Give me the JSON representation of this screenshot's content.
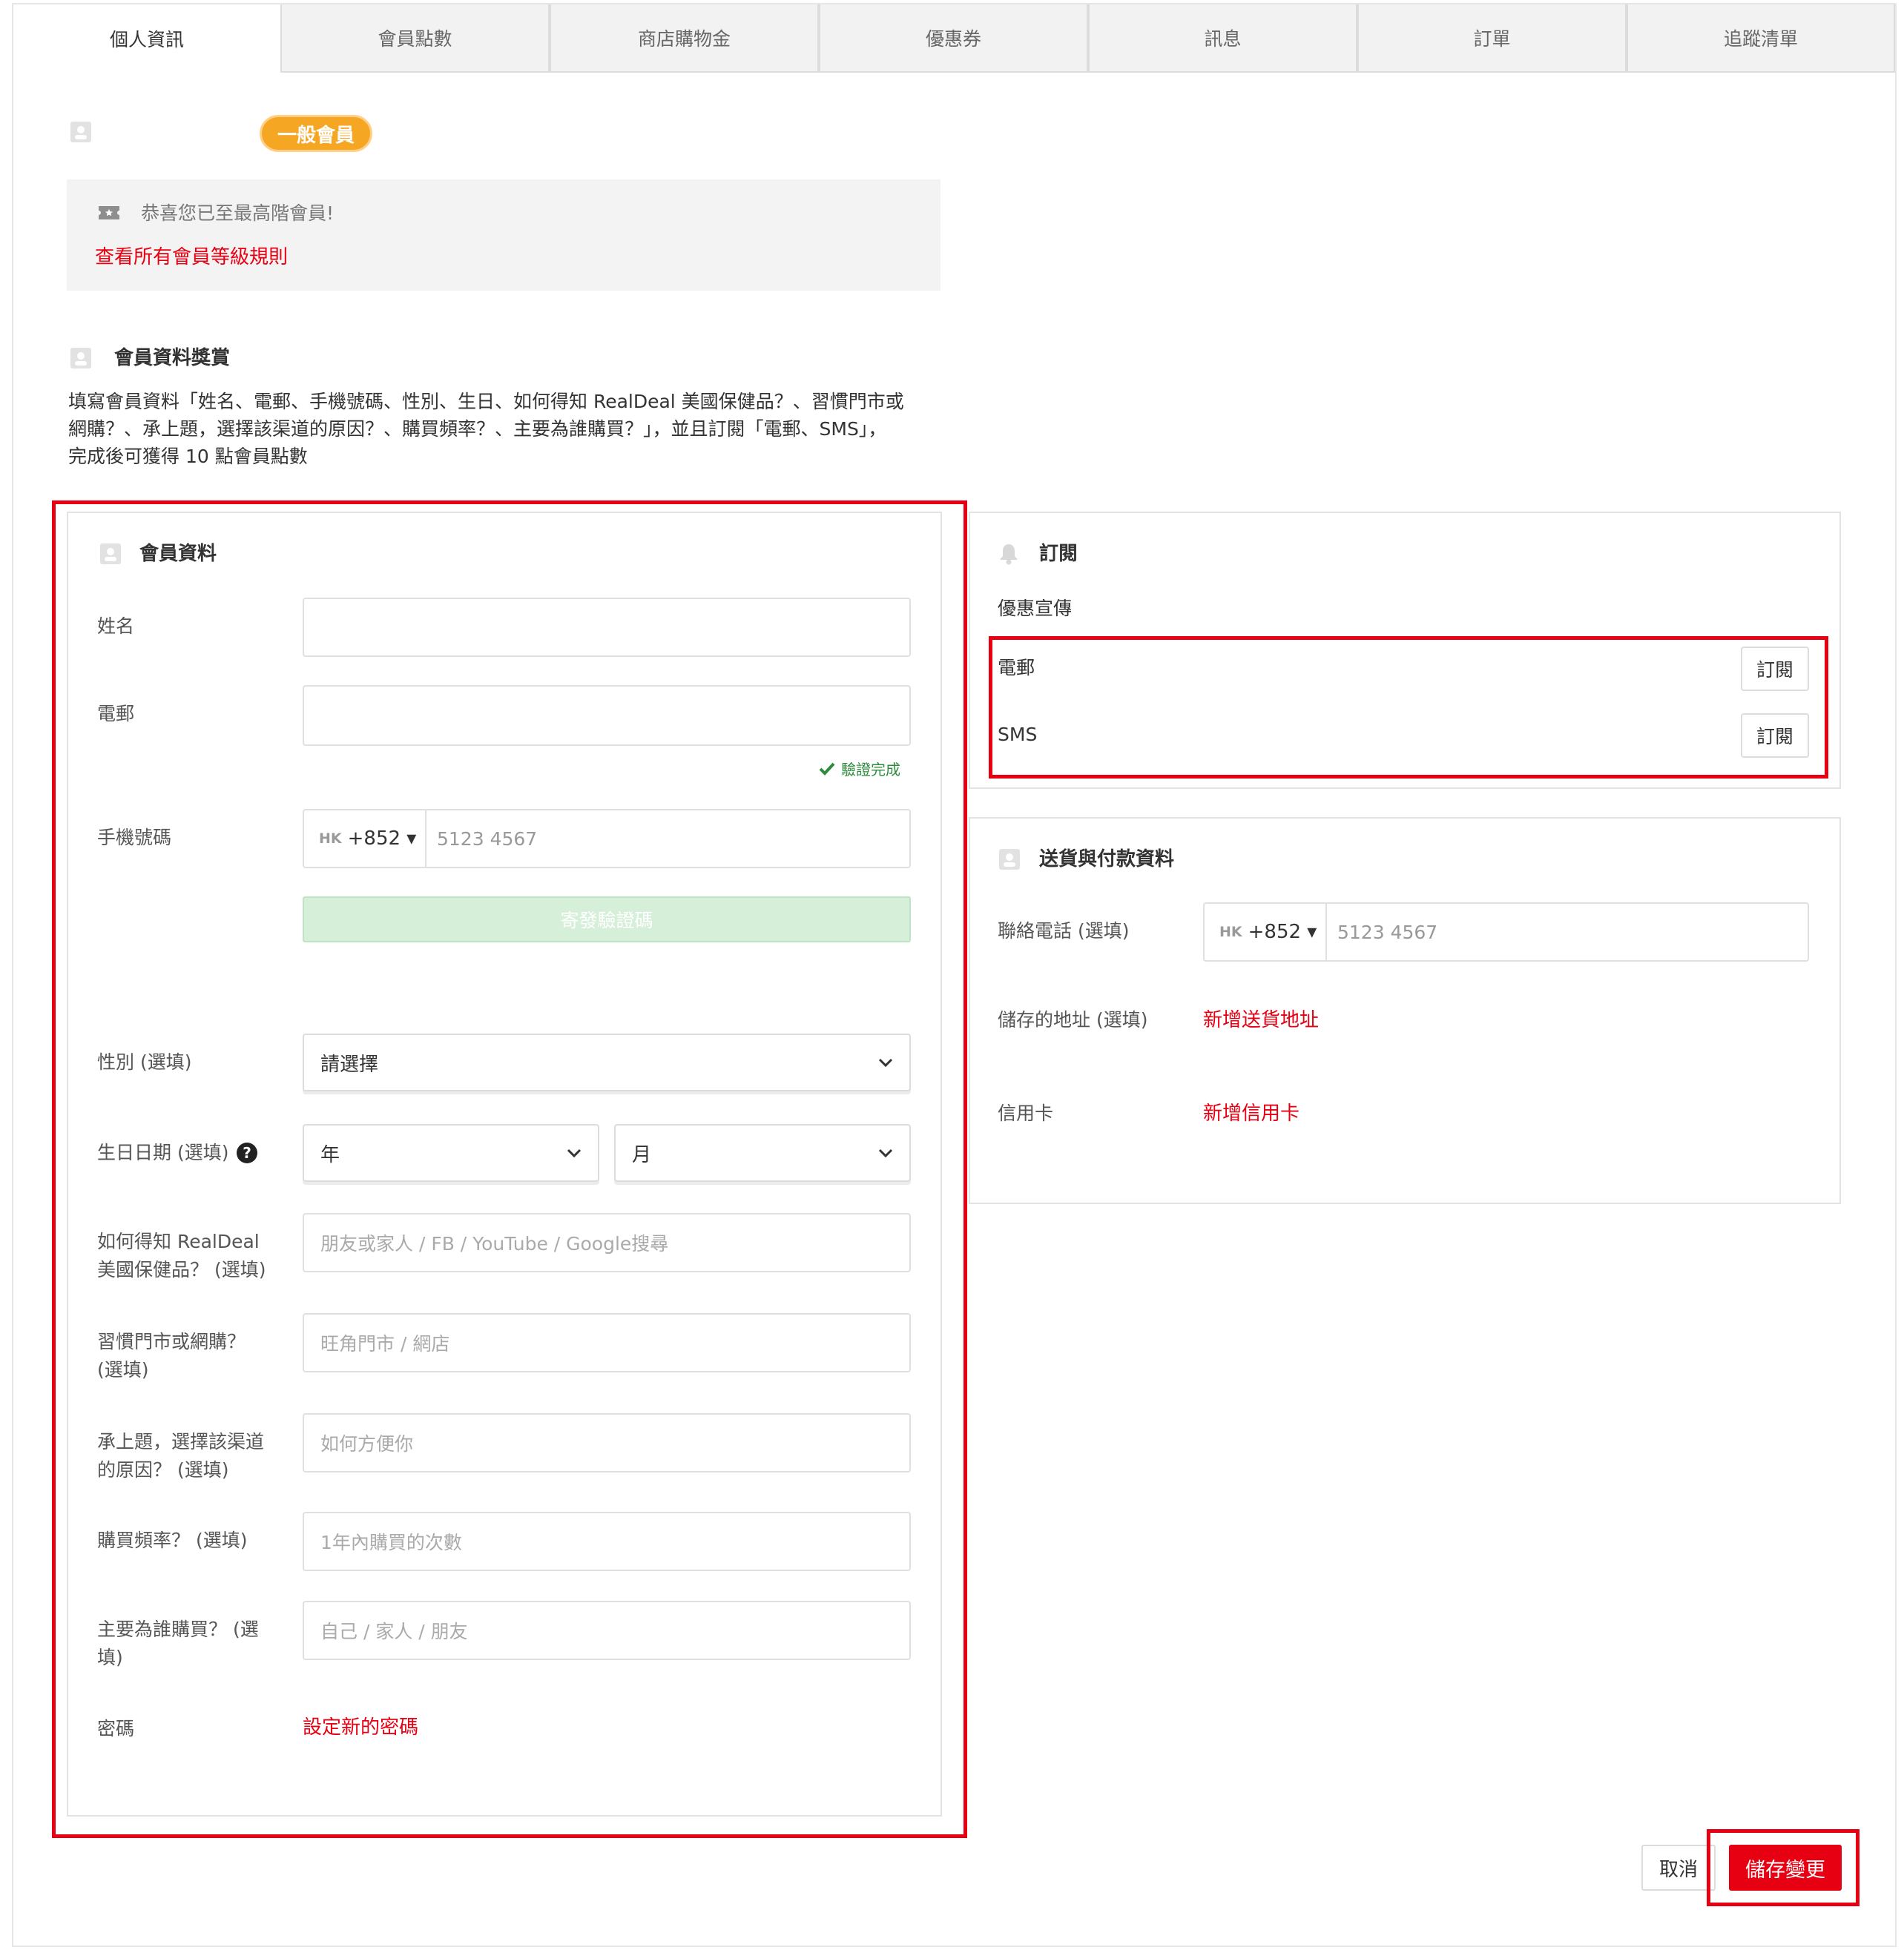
{
  "tabs": [
    "個人資訊",
    "會員點數",
    "商店購物金",
    "優惠券",
    "訊息",
    "訂單",
    "追蹤清單"
  ],
  "member": {
    "badge": "一般會員",
    "tier_message": "恭喜您已至最高階會員!",
    "tier_rules_link": "查看所有會員等級規則"
  },
  "reward": {
    "title": "會員資料獎賞",
    "lines": [
      "填寫會員資料「姓名、電郵、手機號碼、性別、生日、如何得知 RealDeal 美國保健品？、習慣門市或",
      "網購？、承上題，選擇該渠道的原因？、購買頻率？、主要為誰購買？」，並且訂閱「電郵、SMS」，",
      "完成後可獲得 10 點會員點數"
    ]
  },
  "profile": {
    "title": "會員資料",
    "name_label": "姓名",
    "email_label": "電郵",
    "verified_text": "驗證完成",
    "mobile_label": "手機號碼",
    "country_iso": "HK",
    "country_code": "+852 ▾",
    "mobile_placeholder": "5123 4567",
    "send_code_button": "寄發驗證碼",
    "gender_label": "性別 (選填)",
    "gender_value": "請選擇",
    "birthday_label": "生日日期 (選填)",
    "year_value": "年",
    "month_value": "月",
    "source_label_1": "如何得知 RealDeal",
    "source_label_2": "美國保健品？ (選填)",
    "source_placeholder": "朋友或家人 / FB / YouTube / Google搜尋",
    "channel_label_1": "習慣門市或網購？",
    "channel_label_2": "(選填)",
    "channel_placeholder": "旺角門市 / 網店",
    "reason_label_1": "承上題，選擇該渠道",
    "reason_label_2": "的原因？ (選填)",
    "reason_placeholder": "如何方便你",
    "frequency_label": "購買頻率？ (選填)",
    "frequency_placeholder": "1年內購買的次數",
    "for_whom_label_1": "主要為誰購買？ (選",
    "for_whom_label_2": "填)",
    "for_whom_placeholder": "自己 / 家人 / 朋友",
    "password_label": "密碼",
    "password_link": "設定新的密碼"
  },
  "subscription": {
    "title": "訂閱",
    "subtitle": "優惠宣傳",
    "email_label": "電郵",
    "email_button": "訂閱",
    "sms_label": "SMS",
    "sms_button": "訂閱"
  },
  "delivery": {
    "title": "送貨與付款資料",
    "phone_label": "聯絡電話 (選填)",
    "country_iso": "HK",
    "country_code": "+852 ▾",
    "phone_placeholder": "5123 4567",
    "address_label": "儲存的地址 (選填)",
    "address_link": "新增送貨地址",
    "card_label": "信用卡",
    "card_link": "新增信用卡"
  },
  "actions": {
    "cancel": "取消",
    "save": "儲存變更"
  },
  "colors": {
    "accent_red": "#e60012",
    "badge_orange": "#f5a623",
    "verified_green": "#2e8b3e"
  }
}
